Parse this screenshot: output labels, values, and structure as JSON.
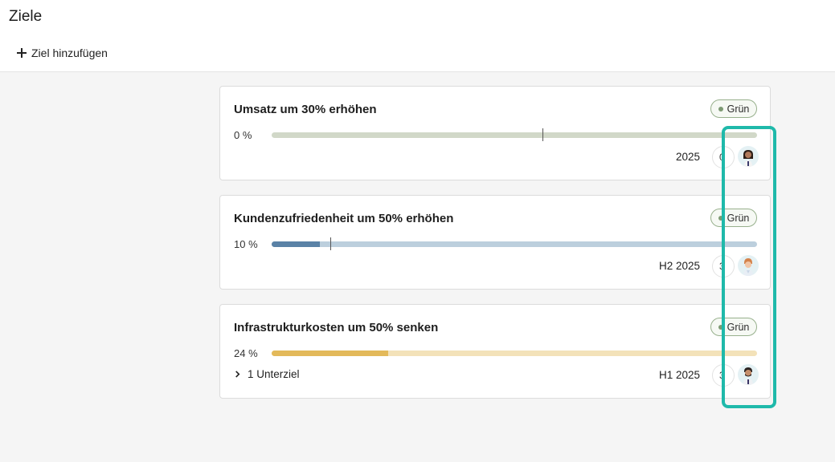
{
  "header": {
    "title": "Ziele",
    "add_label": "Ziel hinzufügen"
  },
  "goals": [
    {
      "title": "Umsatz um 30% erhöhen",
      "status": "Grün",
      "progress_label": "0 %",
      "progress": 0,
      "period": "2025",
      "count": "0",
      "accent": "#d1d8c8",
      "fill": "#7f9a78",
      "avatar": "female-avatar-dark-hair"
    },
    {
      "title": "Kundenzufriedenheit um 50% erhöhen",
      "status": "Grün",
      "progress_label": "10 %",
      "progress": 0.1,
      "period": "H2 2025",
      "count": "3",
      "accent": "#bccfdd",
      "fill": "#5a82a6",
      "avatar": "male-avatar-red-hair"
    },
    {
      "title": "Infrastrukturkosten um 50% senken",
      "status": "Grün",
      "progress_label": "24 %",
      "progress": 0.24,
      "period": "H1 2025",
      "count": "3",
      "accent": "#f3e2b9",
      "fill": "#e3b95a",
      "avatar": "male-avatar-beard",
      "subgoal_label": "1 Unterziel"
    }
  ],
  "colors": {
    "status_green": "#7d9a73",
    "highlight": "#1fb9aa"
  }
}
